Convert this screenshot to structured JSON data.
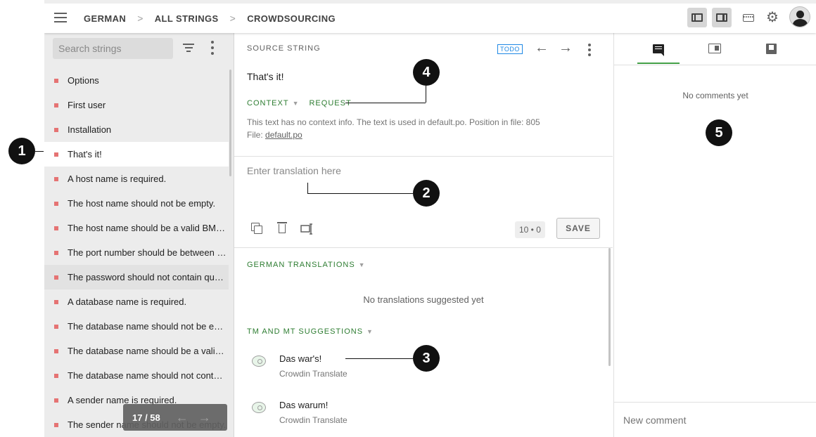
{
  "header": {
    "breadcrumb": [
      "GERMAN",
      "ALL STRINGS",
      "CROWDSOURCING"
    ],
    "separator": ">"
  },
  "left_panel": {
    "search_placeholder": "Search strings",
    "items": [
      {
        "text": "Options"
      },
      {
        "text": "First user"
      },
      {
        "text": "Installation"
      },
      {
        "text": "That's it!"
      },
      {
        "text": "A host name is required."
      },
      {
        "text": "The host name should not be empty."
      },
      {
        "text": "The host name should be a valid BMP-..."
      },
      {
        "text": "The port number should be between {0..."
      },
      {
        "text": "The password should not contain quot..."
      },
      {
        "text": "A database name is required."
      },
      {
        "text": "The database name should not be em..."
      },
      {
        "text": "The database name should be a valid ..."
      },
      {
        "text": "The database name should not contai..."
      },
      {
        "text": "A sender name is required."
      },
      {
        "text": "The sender name should not be empty."
      }
    ],
    "pager": {
      "text": "17 / 58",
      "prev": "←",
      "next": "→"
    }
  },
  "source": {
    "label": "SOURCE STRING",
    "status": "TODO",
    "prev_arrow": "←",
    "next_arrow": "→",
    "text": "That's it!",
    "context_label": "CONTEXT",
    "request_label": "REQUEST",
    "context_desc": "This text has no context info. The text is used in default.po. Position in file: 805",
    "file_prefix": "File: ",
    "file_name": "default.po"
  },
  "editor": {
    "placeholder": "Enter translation here",
    "counter": "10 • 0",
    "save_label": "SAVE"
  },
  "translations": {
    "german_label": "GERMAN TRANSLATIONS",
    "empty": "No translations suggested yet",
    "tm_label": "TM AND MT SUGGESTIONS",
    "suggestions": [
      {
        "text": "Das war's!",
        "source": "Crowdin Translate"
      },
      {
        "text": "Das warum!",
        "source": "Crowdin Translate"
      }
    ]
  },
  "comments": {
    "empty": "No comments yet",
    "input_placeholder": "New comment"
  },
  "callouts": [
    "1",
    "2",
    "3",
    "4",
    "5"
  ],
  "colors": {
    "accent_green": "#2e7d32",
    "tab_underline": "#43a047",
    "todo_blue": "#1e88e5",
    "untranslated_marker": "#e57373"
  }
}
